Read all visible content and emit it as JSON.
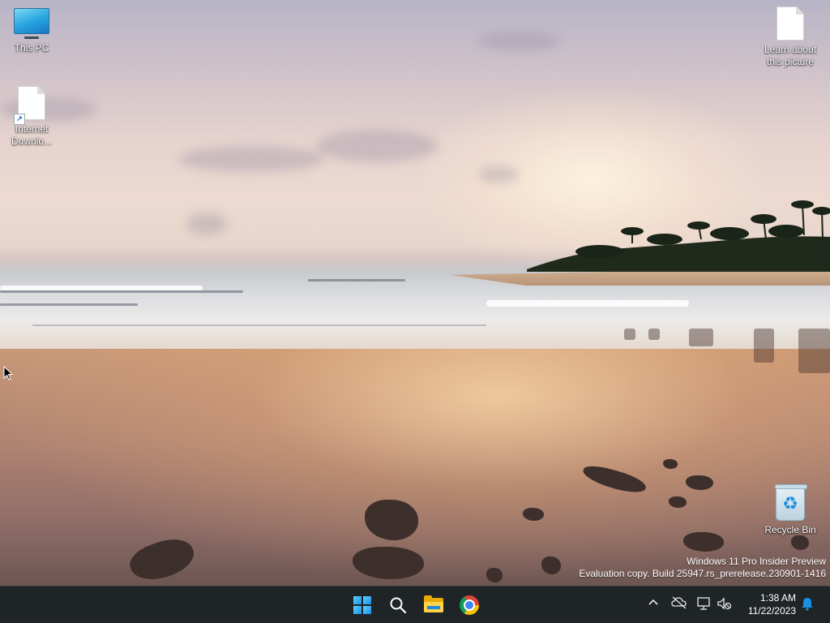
{
  "desktop": {
    "icons": [
      {
        "label": "This PC",
        "icon": "monitor-icon"
      },
      {
        "label": "Internet Downlo...",
        "icon": "file-shortcut-icon"
      },
      {
        "label": "Learn about this picture",
        "icon": "file-icon"
      },
      {
        "label": "Recycle Bin",
        "icon": "recycle-bin-icon"
      }
    ],
    "watermark": {
      "line1": "Windows 11 Pro Insider Preview",
      "line2": "Evaluation copy. Build 25947.rs_prerelease.230901-1416"
    }
  },
  "taskbar": {
    "pinned": [
      {
        "name": "Start",
        "icon": "windows-start-icon"
      },
      {
        "name": "Search",
        "icon": "search-icon"
      },
      {
        "name": "File Explorer",
        "icon": "file-explorer-icon"
      },
      {
        "name": "Google Chrome",
        "icon": "chrome-icon"
      }
    ],
    "tray": {
      "icons": [
        "chevron-up-icon",
        "cloud-offline-icon",
        "network-icon",
        "volume-muted-icon",
        "notification-bell-icon"
      ],
      "time": "1:38 AM",
      "date": "11/22/2023"
    },
    "colors": {
      "background": "#1f2426",
      "accent": "#1b8fe6"
    }
  }
}
